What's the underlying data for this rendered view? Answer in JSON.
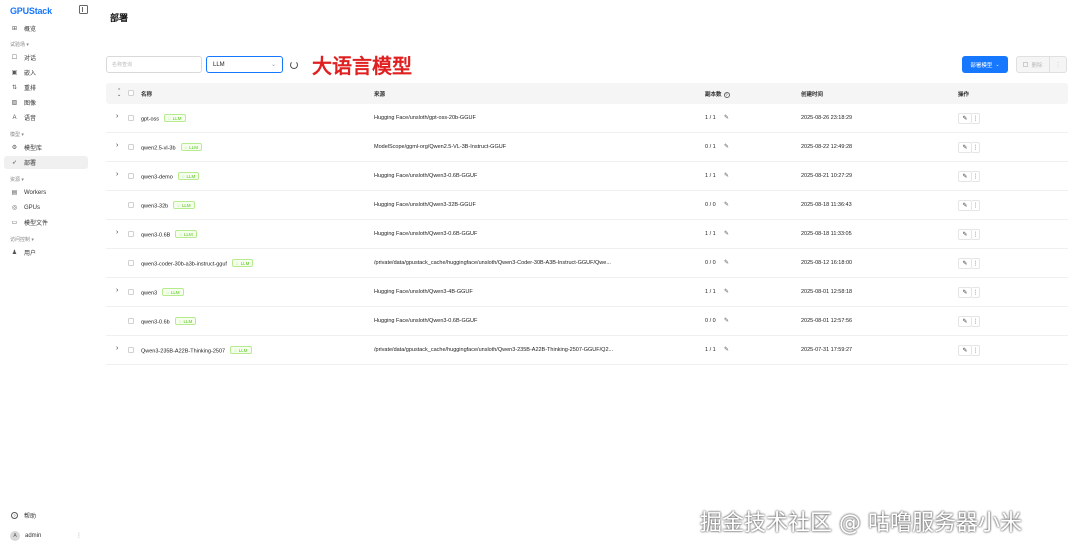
{
  "app": {
    "logo": "GPUStack"
  },
  "sidebar": {
    "groups": [
      {
        "label": "试验场 ▾"
      },
      {
        "label": "模型 ▾"
      },
      {
        "label": "资源 ▾"
      },
      {
        "label": "访问控制 ▾"
      }
    ],
    "items": [
      {
        "label": "概览",
        "icon": "dashboard-icon",
        "glyph": "⊞"
      },
      {
        "label": "对话",
        "icon": "chat-icon",
        "glyph": "☐"
      },
      {
        "label": "嵌入",
        "icon": "embed-icon",
        "glyph": "▣"
      },
      {
        "label": "重排",
        "icon": "rerank-icon",
        "glyph": "⇅"
      },
      {
        "label": "图像",
        "icon": "image-icon",
        "glyph": "▨"
      },
      {
        "label": "语音",
        "icon": "audio-icon",
        "glyph": "A"
      },
      {
        "label": "模型库",
        "icon": "model-catalog-icon",
        "glyph": "⚙"
      },
      {
        "label": "部署",
        "icon": "rocket-icon",
        "glyph": "➶"
      },
      {
        "label": "Workers",
        "icon": "server-icon",
        "glyph": "▤"
      },
      {
        "label": "GPUs",
        "icon": "gpu-icon",
        "glyph": "◎"
      },
      {
        "label": "模型文件",
        "icon": "file-icon",
        "glyph": "▭"
      },
      {
        "label": "用户",
        "icon": "users-icon",
        "glyph": "♟"
      }
    ],
    "help": "帮助",
    "user": {
      "name": "admin",
      "avatar": "A",
      "more": "⋮"
    }
  },
  "page": {
    "title": "部署"
  },
  "toolbar": {
    "search_placeholder": "名称查询",
    "filter_value": "LLM",
    "annotation": "大语言模型",
    "deploy_label": "部署模型",
    "delete_label": "删除",
    "more": "⋮"
  },
  "table": {
    "columns": {
      "name": "名称",
      "source": "来源",
      "replicas": "副本数",
      "created": "创建时间",
      "actions": "操作"
    },
    "rows": [
      {
        "name": "gpt-oss",
        "tag": "LLM",
        "source": "Hugging Face/unsloth/gpt-oss-20b-GGUF",
        "replicas": "1 / 1",
        "created": "2025-08-26 23:18:29",
        "expandable": true
      },
      {
        "name": "qwen2.5-vl-3b",
        "tag": "LLM",
        "source": "ModelScope/ggml-org/Qwen2.5-VL-3B-Instruct-GGUF",
        "replicas": "0 / 1",
        "created": "2025-08-22 12:49:28",
        "expandable": true
      },
      {
        "name": "qwen3-demo",
        "tag": "LLM",
        "source": "Hugging Face/unsloth/Qwen3-0.6B-GGUF",
        "replicas": "1 / 1",
        "created": "2025-08-21 10:27:29",
        "expandable": true
      },
      {
        "name": "qwen3-32b",
        "tag": "LLM",
        "source": "Hugging Face/unsloth/Qwen3-32B-GGUF",
        "replicas": "0 / 0",
        "created": "2025-08-18 11:36:43",
        "expandable": false
      },
      {
        "name": "qwen3-0.6B",
        "tag": "LLM",
        "source": "Hugging Face/unsloth/Qwen3-0.6B-GGUF",
        "replicas": "1 / 1",
        "created": "2025-08-18 11:33:05",
        "expandable": true
      },
      {
        "name": "qwen3-coder-30b-a3b-instruct-gguf",
        "tag": "LLM",
        "source": "/private/data/gpustack_cache/huggingface/unsloth/Qwen3-Coder-30B-A3B-Instruct-GGUF/Qwe...",
        "replicas": "0 / 0",
        "created": "2025-08-12 16:18:00",
        "expandable": false
      },
      {
        "name": "qwen3",
        "tag": "LLM",
        "source": "Hugging Face/unsloth/Qwen3-4B-GGUF",
        "replicas": "1 / 1",
        "created": "2025-08-01 12:58:18",
        "expandable": true
      },
      {
        "name": "qwen3-0.6b",
        "tag": "LLM",
        "source": "Hugging Face/unsloth/Qwen3-0.6B-GGUF",
        "replicas": "0 / 0",
        "created": "2025-08-01 12:57:56",
        "expandable": false
      },
      {
        "name": "Qwen3-235B-A22B-Thinking-2507",
        "tag": "LLM",
        "source": "/private/data/gpustack_cache/huggingface/unsloth/Qwen3-235B-A22B-Thinking-2507-GGUF/Q2...",
        "replicas": "1 / 1",
        "created": "2025-07-31 17:59:27",
        "expandable": true
      }
    ]
  },
  "watermark": "掘金技术社区 @ 咕噜服务器小米"
}
